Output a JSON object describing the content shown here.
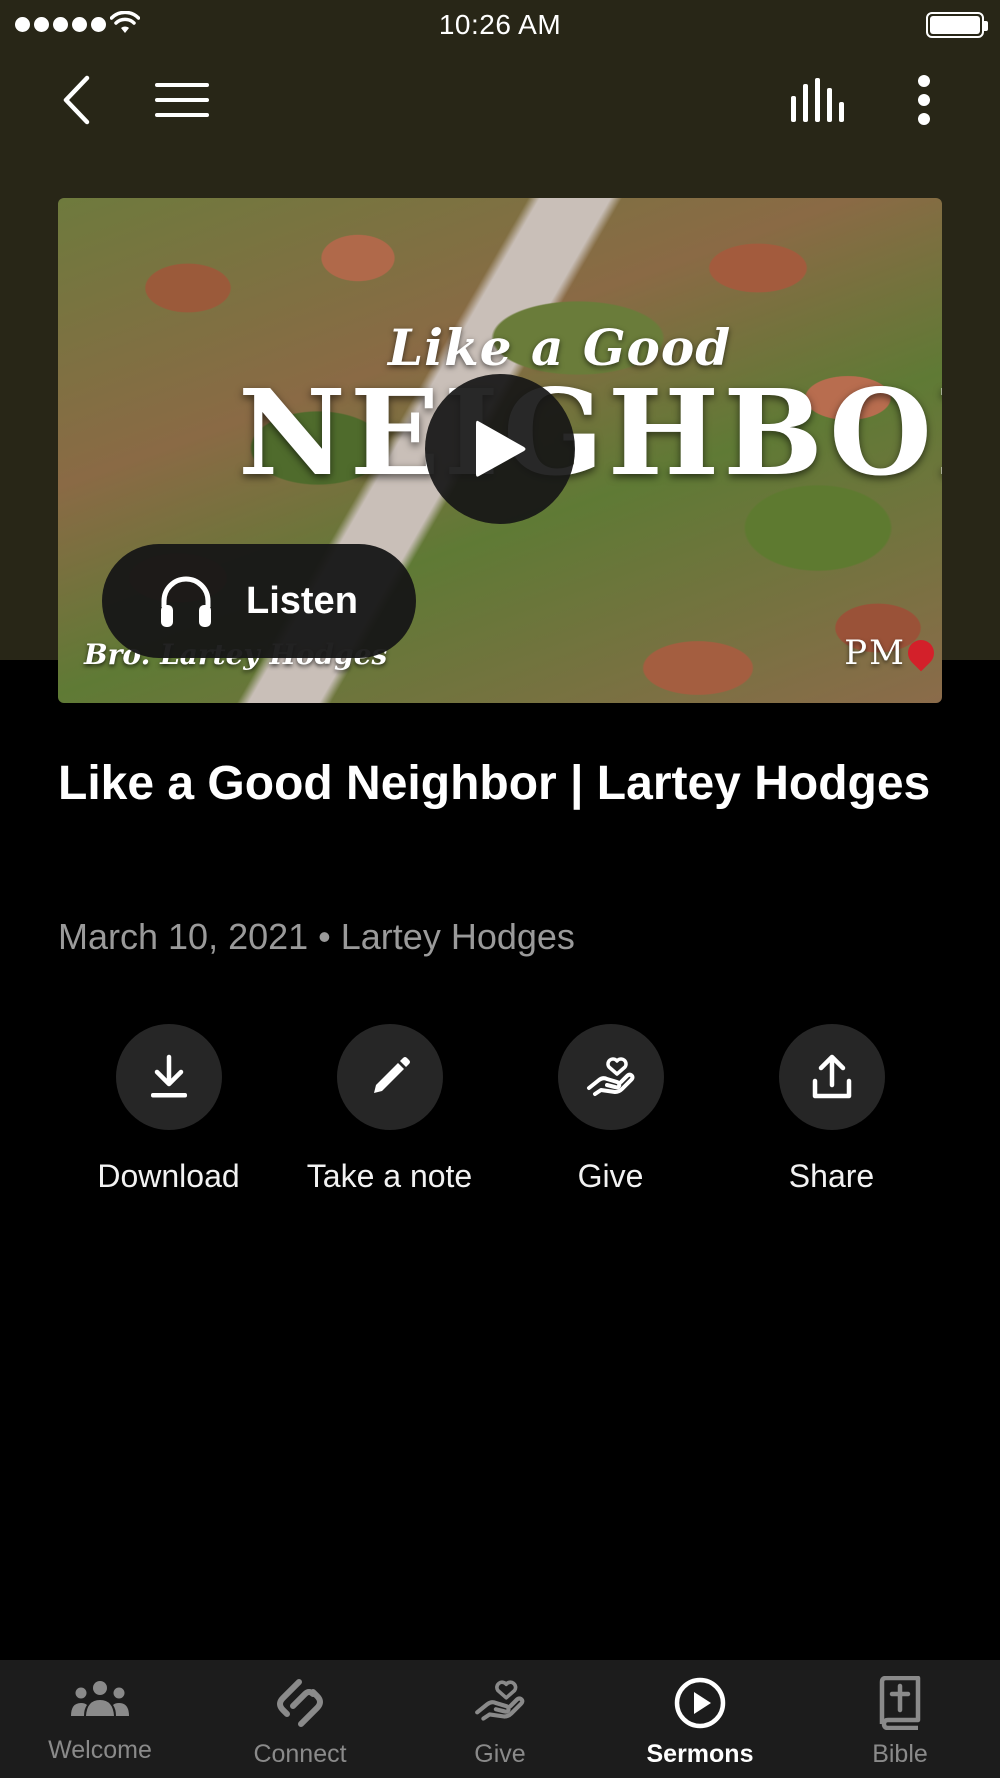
{
  "status_bar": {
    "time": "10:26 AM"
  },
  "nav": {
    "back_icon": "chevron-left-icon",
    "menu_icon": "hamburger-menu-icon",
    "audio_icon": "audio-bars-icon",
    "more_icon": "more-vertical-icon"
  },
  "hero": {
    "image_title_small": "Like a Good",
    "image_title_big": "NEIGHBOR",
    "image_speaker": "Bro. Lartey Hodges",
    "image_logo": "PM",
    "listen_label": "Listen"
  },
  "sermon": {
    "title": "Like a Good Neighbor | Lartey Hodges",
    "meta": "March 10, 2021 • Lartey Hodges"
  },
  "actions": [
    {
      "label": "Download",
      "icon": "download-icon"
    },
    {
      "label": "Take a note",
      "icon": "pencil-icon"
    },
    {
      "label": "Give",
      "icon": "heart-hand-icon"
    },
    {
      "label": "Share",
      "icon": "share-icon"
    }
  ],
  "tabs": [
    {
      "label": "Welcome",
      "icon": "people-icon",
      "active": false
    },
    {
      "label": "Connect",
      "icon": "connect-icon",
      "active": false
    },
    {
      "label": "Give",
      "icon": "heart-hand-icon",
      "active": false
    },
    {
      "label": "Sermons",
      "icon": "play-circle-icon",
      "active": true
    },
    {
      "label": "Bible",
      "icon": "bible-icon",
      "active": false
    }
  ],
  "colors": {
    "header_bg": "#282617",
    "page_bg": "#000000",
    "tab_bar_bg": "#1c1c1c",
    "inactive_tab": "#8a8a8a"
  }
}
